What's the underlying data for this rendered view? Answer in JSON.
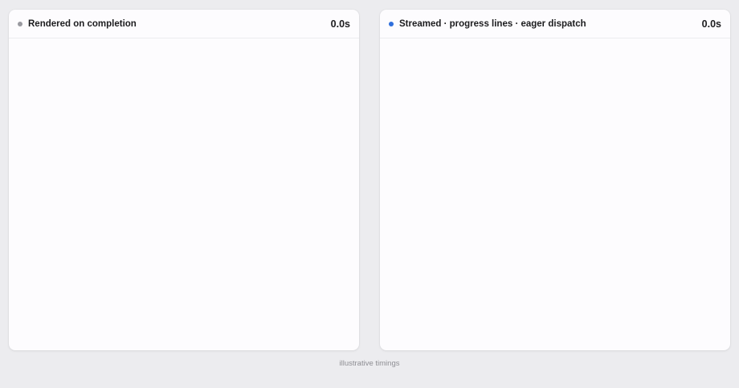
{
  "panels": [
    {
      "title": "Rendered on completion",
      "time": "0.0s",
      "dot_color": "#9a9aa0"
    },
    {
      "title": "Streamed · progress lines · eager dispatch",
      "time": "0.0s",
      "dot_color": "#2f6fdc"
    }
  ],
  "footer": {
    "note": "illustrative timings"
  }
}
